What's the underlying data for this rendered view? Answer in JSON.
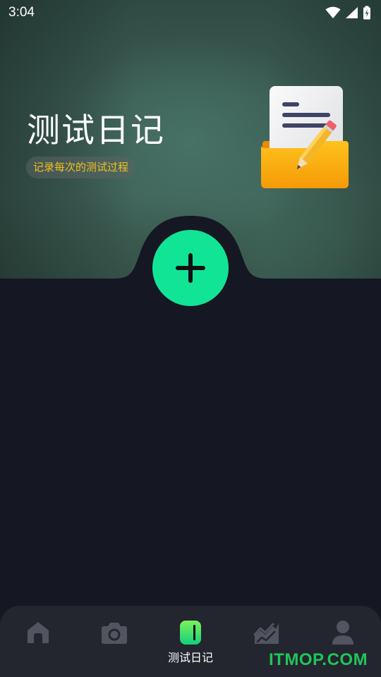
{
  "status_bar": {
    "time": "3:04",
    "icons": [
      "wifi-icon",
      "signal-icon",
      "battery-icon"
    ]
  },
  "header": {
    "title": "测试日记",
    "subtitle": "记录每次的测试过程",
    "illustration": "notebook-pencil-icon"
  },
  "fab": {
    "icon": "plus-icon",
    "color": "#12e496"
  },
  "tabbar": {
    "active_index": 2,
    "active_label": "测试日记",
    "items": [
      {
        "icon": "home-icon"
      },
      {
        "icon": "camera-icon"
      },
      {
        "icon": "diary-icon",
        "label": "测试日记"
      },
      {
        "icon": "trend-chart-icon"
      },
      {
        "icon": "profile-icon"
      }
    ]
  },
  "watermark": "ITMOP.COM",
  "colors": {
    "accent": "#12e496",
    "subtitle": "#f2c21b",
    "background": "#151722",
    "tabbar": "#23252f",
    "watermark": "#20c55a"
  }
}
